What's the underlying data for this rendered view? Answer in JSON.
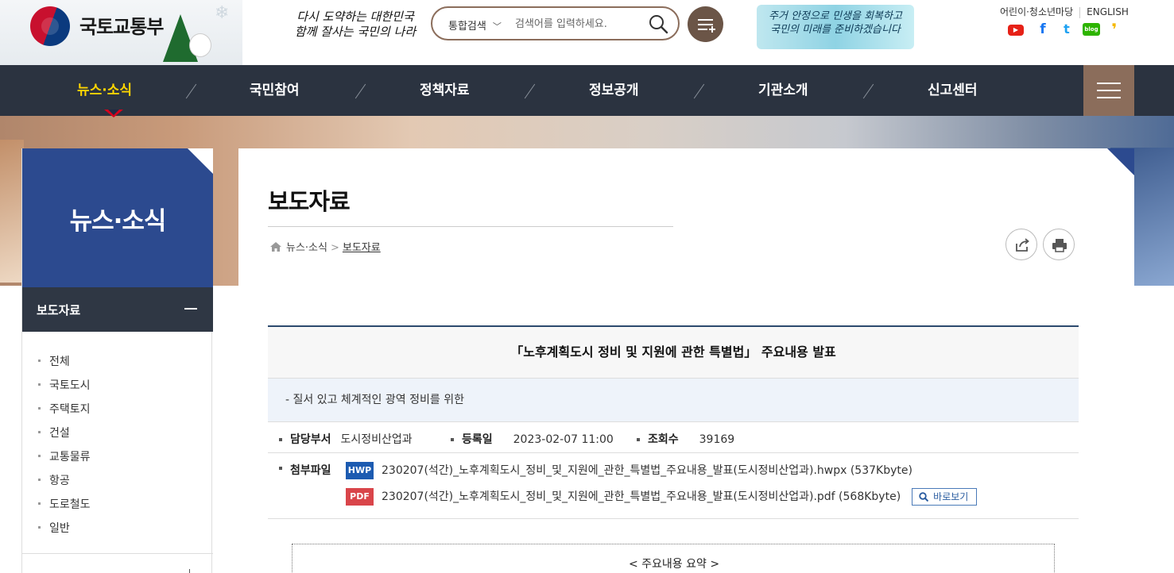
{
  "header": {
    "logo_text": "국토교통부",
    "slogan_line1": "다시 도약하는 대한민국",
    "slogan_line2": "함께 잘사는 국민의 나라",
    "search": {
      "scope_label": "통합검색",
      "placeholder": "검색어를 입력하세요."
    },
    "promo_line1": "주거 안정으로 민생을 회복하고",
    "promo_line2": "국민의 미래를 준비하겠습니다",
    "util_links": {
      "kids": "어린이·청소년마당",
      "english": "ENGLISH"
    },
    "sns": [
      {
        "name": "youtube-icon",
        "glyph": "▶",
        "color": "#e62117"
      },
      {
        "name": "facebook-icon",
        "glyph": "f",
        "color": "#1877f2"
      },
      {
        "name": "twitter-icon",
        "glyph": "t",
        "color": "#1da1f2"
      },
      {
        "name": "blog-icon",
        "glyph": "blog",
        "color": "#2db400"
      },
      {
        "name": "kakao-story-icon",
        "glyph": "❜",
        "color": "#f5b800"
      }
    ]
  },
  "gnb": {
    "items": [
      "뉴스·소식",
      "국민참여",
      "정책자료",
      "정보공개",
      "기관소개",
      "신고센터"
    ],
    "active_index": 0
  },
  "lnb": {
    "title": "뉴스·소식",
    "section": "보도자료",
    "items": [
      "전체",
      "국토도시",
      "주택토지",
      "건설",
      "교통물류",
      "항공",
      "도로철도",
      "일반"
    ]
  },
  "page": {
    "title": "보도자료",
    "breadcrumb": [
      "뉴스·소식",
      "보도자료"
    ]
  },
  "article": {
    "title": "「노후계획도시 정비 및 지원에 관한 특별법」 주요내용 발표",
    "subtitle": "-  질서 있고 체계적인 광역 정비를 위한",
    "dept_label": "담당부서",
    "dept": "도시정비산업과",
    "date_label": "등록일",
    "date": "2023-02-07 11:00",
    "views_label": "조회수",
    "views": "39169",
    "files_label": "첨부파일",
    "files": [
      {
        "type": "HWP",
        "name": "230207(석간)_노후계획도시_정비_및_지원에_관한_특별법_주요내용_발표(도시정비산업과).hwpx (537Kbyte)"
      },
      {
        "type": "PDF",
        "name": "230207(석간)_노후계획도시_정비_및_지원에_관한_특별법_주요내용_발표(도시정비산업과).pdf (568Kbyte)"
      }
    ],
    "preview_label": "바로보기",
    "summary_title": "< 주요내용 요약 >"
  },
  "colors": {
    "gnb_bg": "#2b3340",
    "gnb_active": "#ffd400",
    "lnb_title_bg": "#2c4a8f",
    "accent_brown": "#8b6d5b"
  }
}
